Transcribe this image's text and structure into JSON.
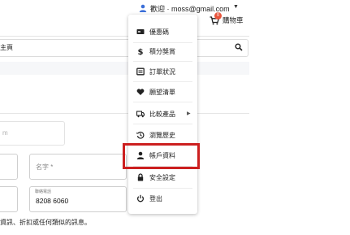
{
  "header": {
    "greeting": "歡迎 · moss@gmail.com",
    "caret": "▼",
    "cart_label": "購物車",
    "cart_count": "0"
  },
  "breadcrumb": "主頁",
  "form": {
    "email_placeholder": "m",
    "name_label": "名字 *",
    "phone_label": "聯絡電話",
    "phone_value": "8208 6060"
  },
  "notice": "資訊、折扣或任何類似的訊息。",
  "menu": {
    "items": [
      {
        "label": "優惠碼",
        "icon": "coupon-icon"
      },
      {
        "label": "積分獎賞",
        "icon": "dollar-icon"
      },
      {
        "label": "訂單狀況",
        "icon": "order-list-icon"
      },
      {
        "label": "願望清單",
        "icon": "heart-icon"
      },
      {
        "label": "比較產品",
        "icon": "compare-truck-icon",
        "arrow": "▶"
      },
      {
        "label": "瀏覽歷史",
        "icon": "history-icon"
      },
      {
        "label": "帳戶資料",
        "icon": "person-icon"
      },
      {
        "label": "安全設定",
        "icon": "lock-icon"
      },
      {
        "label": "登出",
        "icon": "power-icon"
      }
    ]
  },
  "colors": {
    "highlight": "#cc1f1f",
    "badge": "#e8543b",
    "accent_user": "#3b6fd8"
  }
}
